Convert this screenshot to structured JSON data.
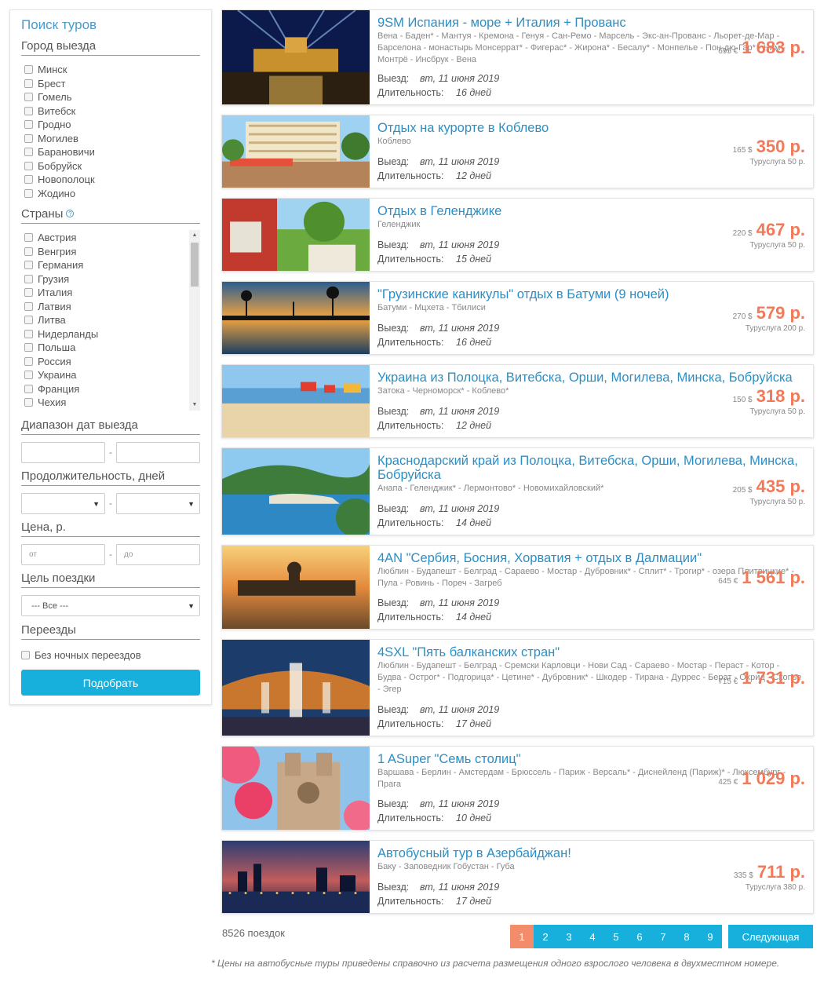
{
  "sidebar": {
    "title": "Поиск туров",
    "city_heading": "Город выезда",
    "cities": [
      "Минск",
      "Брест",
      "Гомель",
      "Витебск",
      "Гродно",
      "Могилев",
      "Барановичи",
      "Бобруйск",
      "Новополоцк",
      "Жодино"
    ],
    "countries_heading": "Страны",
    "countries_help_icon": "?",
    "countries": [
      "Австрия",
      "Венгрия",
      "Германия",
      "Грузия",
      "Италия",
      "Латвия",
      "Литва",
      "Нидерланды",
      "Польша",
      "Россия",
      "Украина",
      "Франция",
      "Чехия"
    ],
    "dates_heading": "Диапазон дат выезда",
    "duration_heading": "Продолжительность, дней",
    "price_heading": "Цена, р.",
    "price_from_placeholder": "от",
    "price_to_placeholder": "до",
    "purpose_heading": "Цель поездки",
    "purpose_selected": "--- Все ---",
    "transfers_heading": "Переезды",
    "no_night_label": "Без ночных переездов",
    "submit_label": "Подобрать",
    "dash": "-"
  },
  "labels": {
    "departure": "Выезд:",
    "duration": "Длительность:"
  },
  "tours": [
    {
      "title": "9SM Испания - море + Италия + Прованс",
      "route": "Вена - Баден* - Мантуя - Кремона - Генуя - Сан-Ремо - Марсель - Экс-ан-Прованс - Льорет-де-Мар - Барселона - монастырь Монсеррат* - Фигерас* - Жирона* - Бесалу* - Монпелье - Пон-дю-Гар* - Ним - Монтрё - Инсбрук - Вена",
      "date": "вт, 11 июня 2019",
      "days": "16 дней",
      "cur": "695 €",
      "price": "1 683 р.",
      "fee": "",
      "scene": "castle"
    },
    {
      "title": "Отдых на курорте в Коблево",
      "route": "Коблево",
      "date": "вт, 11 июня 2019",
      "days": "12 дней",
      "cur": "165 $",
      "price": "350 р.",
      "fee": "Туруслуга 50 р.",
      "scene": "hotel"
    },
    {
      "title": "Отдых в Геленджике",
      "route": "Геленджик",
      "date": "вт, 11 июня 2019",
      "days": "15 дней",
      "cur": "220 $",
      "price": "467 р.",
      "fee": "Туруслуга 50 р.",
      "scene": "garden"
    },
    {
      "title": "\"Грузинские каникулы\" отдых в Батуми (9 ночей)",
      "route": "Батуми - Мцхета - Тбилиси",
      "date": "вт, 11 июня 2019",
      "days": "16 дней",
      "cur": "270 $",
      "price": "579 р.",
      "fee": "Туруслуга 200 р.",
      "scene": "sunset"
    },
    {
      "title": "Украина из Полоцка, Витебска, Орши, Могилева, Минска, Бобруйска",
      "route": "Затока - Черноморск* - Коблево*",
      "date": "вт, 11 июня 2019",
      "days": "12 дней",
      "cur": "150 $",
      "price": "318 р.",
      "fee": "Туруслуга 50 р.",
      "scene": "beach"
    },
    {
      "title": "Краснодарский край из Полоцка, Витебска, Орши, Могилева, Минска, Бобруйска",
      "route": "Анапа - Геленджик* - Лермонтово* - Новомихайловский*",
      "date": "вт, 11 июня 2019",
      "days": "14 дней",
      "cur": "205 $",
      "price": "435 р.",
      "fee": "Туруслуга 50 р.",
      "scene": "bay"
    },
    {
      "title": "4AN \"Сербия, Босния, Хорватия + отдых в Далмации\"",
      "route": "Люблин - Будапешт - Белград - Сараево - Мостар - Дубровник* - Сплит* - Трогир* - озера Плитвицкие* - Пула - Ровинь - Пореч - Загреб",
      "date": "вт, 11 июня 2019",
      "days": "14 дней",
      "cur": "645 €",
      "price": "1 561 р.",
      "fee": "",
      "scene": "parliament"
    },
    {
      "title": "4SXL \"Пять балканских стран\"",
      "route": "Люблин - Будапешт - Белград - Сремски Карловци - Нови Сад - Сараево - Мостар - Пераст - Котор - Будва - Острог* - Подгорица* - Цетине* - Дубровник* - Шкодер - Тирана - Дуррес - Берат - Охрид - Скопье - Эгер",
      "date": "вт, 11 июня 2019",
      "days": "17 дней",
      "cur": "715 €",
      "price": "1 731 р.",
      "fee": "",
      "scene": "fountain"
    },
    {
      "title": "1 ASuper \"Семь столиц\"",
      "route": "Варшава - Берлин - Амстердам - Брюссель - Париж - Версаль* - Диснейленд (Париж)* - Люксембург - Прага",
      "date": "вт, 11 июня 2019",
      "days": "10 дней",
      "cur": "425 €",
      "price": "1 029 р.",
      "fee": "",
      "scene": "cathedral"
    },
    {
      "title": "Автобусный тур в Азербайджан!",
      "route": "Баку - Заповедник Гобустан - Губа",
      "date": "вт, 11 июня 2019",
      "days": "17 дней",
      "cur": "335 $",
      "price": "711 р.",
      "fee": "Туруслуга 380 р.",
      "scene": "city"
    }
  ],
  "footer": {
    "count": "8526 поездок",
    "pages": [
      "1",
      "2",
      "3",
      "4",
      "5",
      "6",
      "7",
      "8",
      "9"
    ],
    "next_label": "Следующая",
    "note": "* Цены на автобусные туры приведены справочно из расчета размещения одного взрослого человека в двухместном номере."
  }
}
